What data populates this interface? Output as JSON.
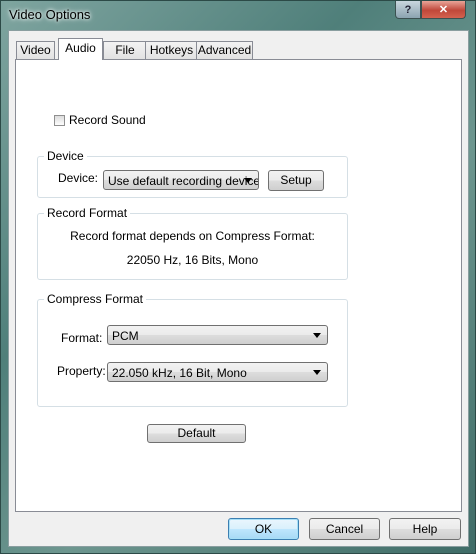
{
  "window": {
    "title": "Video Options",
    "help_label": "?",
    "close_label": "✕"
  },
  "tabs": [
    {
      "label": "Video",
      "active": false
    },
    {
      "label": "Audio",
      "active": true
    },
    {
      "label": "File",
      "active": false
    },
    {
      "label": "Hotkeys",
      "active": false
    },
    {
      "label": "Advanced",
      "active": false
    }
  ],
  "audio": {
    "record_sound": {
      "label": "Record Sound",
      "checked": false
    },
    "device_group": {
      "title": "Device",
      "device_label": "Device:",
      "device_value": "Use default recording device",
      "setup_label": "Setup"
    },
    "record_format_group": {
      "title": "Record Format",
      "line1": "Record format depends on Compress Format:",
      "line2": "22050 Hz, 16 Bits, Mono"
    },
    "compress_group": {
      "title": "Compress Format",
      "format_label": "Format:",
      "format_value": "PCM",
      "property_label": "Property:",
      "property_value": "22.050 kHz, 16 Bit, Mono"
    },
    "default_label": "Default"
  },
  "footer": {
    "ok_label": "OK",
    "cancel_label": "Cancel",
    "help_label": "Help"
  }
}
